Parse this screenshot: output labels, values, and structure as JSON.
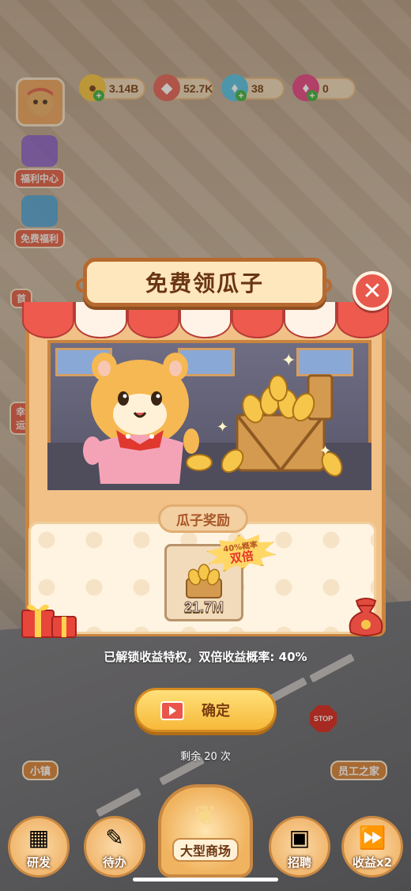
{
  "resources": {
    "coins": "3.14B",
    "gems_red": "52.7K",
    "diamonds": "38",
    "pink_gems": "0"
  },
  "side_menu": {
    "welfare_center": "福利中心",
    "free_welfare": "免费福利",
    "partial_1": "首",
    "partial_2": "幸运"
  },
  "popup": {
    "title": "免费领瓜子",
    "close_symbol": "✕",
    "reward_section_label": "瓜子奖励",
    "reward_amount": "21.7M",
    "double_badge_top": "40%概率",
    "double_badge_main": "双倍",
    "privilege_text": "已解锁收益特权，双倍收益概率: 40%",
    "confirm_label": "确定",
    "remaining_text": "剩余 20 次"
  },
  "map_labels": {
    "small_town": "小镇",
    "staff_home": "员工之家",
    "stop_sign": "STOP"
  },
  "bottom_nav": {
    "research": "研发",
    "todo": "待办",
    "mall": "大型商场",
    "hire": "招聘",
    "income": "收益x2"
  },
  "colors": {
    "accent_red": "#e8584c",
    "frame_brown": "#c9853f",
    "button_yellow": "#f7b93a"
  }
}
